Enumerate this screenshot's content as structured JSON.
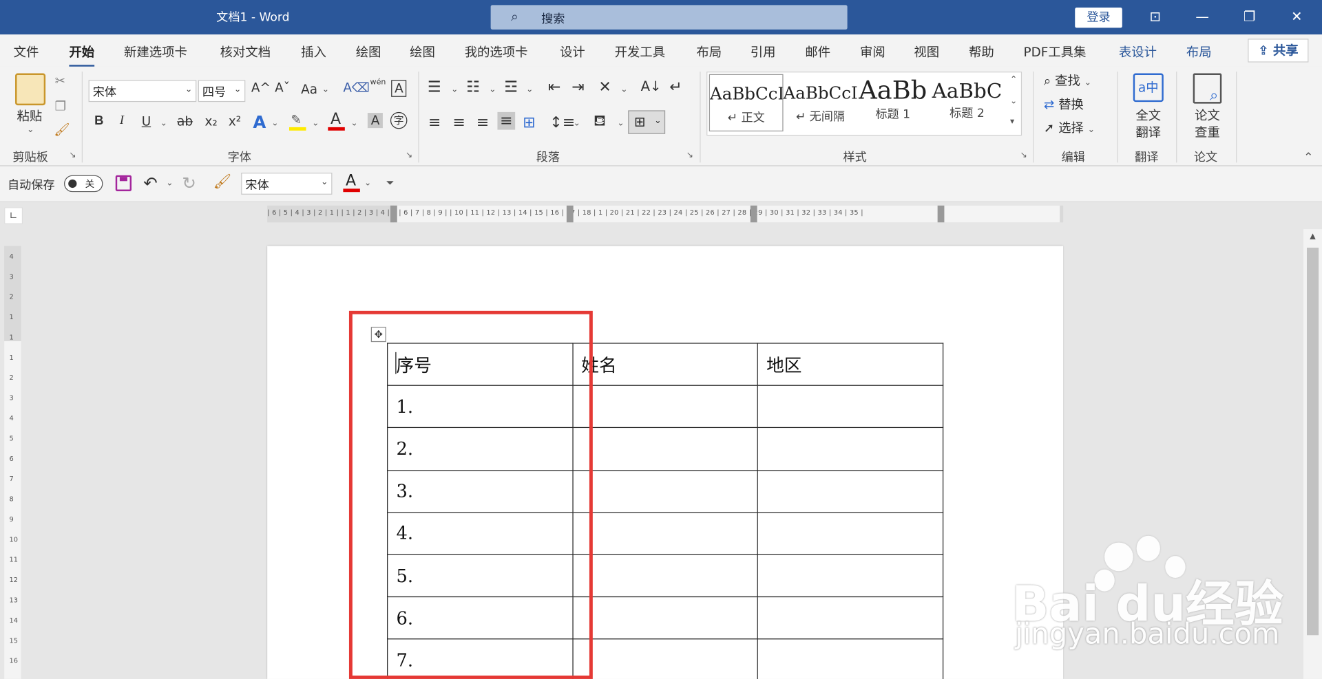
{
  "window": {
    "title": "文档1  -  Word",
    "search_placeholder": "搜索",
    "login": "登录"
  },
  "menu": {
    "tabs": [
      "文件",
      "开始",
      "新建选项卡",
      "核对文档",
      "插入",
      "绘图",
      "绘图",
      "我的选项卡",
      "设计",
      "开发工具",
      "布局",
      "引用",
      "邮件",
      "审阅",
      "视图",
      "帮助",
      "PDF工具集",
      "表设计",
      "布局"
    ],
    "active": "开始",
    "share": "共享"
  },
  "ribbon": {
    "clipboard": {
      "paste": "粘贴",
      "group": "剪贴板"
    },
    "font": {
      "name": "宋体",
      "size": "四号",
      "group": "字体",
      "case": "Aa",
      "bold": "B",
      "italic": "I",
      "underline": "U",
      "strike": "ab",
      "sub": "x₂",
      "sup": "x²",
      "grow": "A^",
      "shrink": "Aˇ",
      "pinyin": "wén",
      "charborder": "A",
      "phonetic": "A",
      "shading": "A",
      "enclose": "字"
    },
    "paragraph": {
      "group": "段落"
    },
    "styles": {
      "group": "样式",
      "items": [
        {
          "sample": "AaBbCcI",
          "name": "↵ 正文"
        },
        {
          "sample": "AaBbCcI",
          "name": "↵ 无间隔"
        },
        {
          "sample": "AaBb",
          "name": "标题 1"
        },
        {
          "sample": "AaBbC",
          "name": "标题 2"
        }
      ]
    },
    "editing": {
      "group": "编辑",
      "find": "查找",
      "replace": "替换",
      "select": "选择"
    },
    "translate": {
      "group": "翻译",
      "label1": "全文",
      "label2": "翻译"
    },
    "paper": {
      "group": "论文",
      "label1": "论文",
      "label2": "查重"
    }
  },
  "qat": {
    "autosave": "自动保存",
    "toggle": "关",
    "font": "宋体",
    "fontcolor": "A"
  },
  "ruler": {
    "h_numbers": "| 6 | 5 | 4 | 3 | 2 | 1 |   | 1 | 2 | 3 | 4 | 5 | 6 | 7 | 8 | 9 |   | 10 | 11 | 12 | 13 | 14 | 15 | 16 | 17 | 18 | 1   | 20 | 21 | 22 | 23 | 24 | 25 | 26 | 27 | 28 | 29 | 30 | 31 | 32 | 33 | 34 | 35 |",
    "v_numbers": [
      "4",
      "3",
      "2",
      "1",
      "1",
      "1",
      "2",
      "3",
      "4",
      "5",
      "6",
      "7",
      "8",
      "9",
      "10",
      "11",
      "12",
      "13",
      "14",
      "15",
      "16"
    ]
  },
  "table": {
    "rows": [
      [
        "序号",
        "姓名",
        "地区"
      ],
      [
        "1.",
        "",
        ""
      ],
      [
        "2.",
        "",
        ""
      ],
      [
        "3.",
        "",
        ""
      ],
      [
        "4.",
        "",
        ""
      ],
      [
        "5.",
        "",
        ""
      ],
      [
        "6.",
        "",
        ""
      ],
      [
        "7.",
        "",
        ""
      ]
    ]
  },
  "watermark": {
    "brand": "Bai du经验",
    "url": "jingyan.baidu.com"
  }
}
